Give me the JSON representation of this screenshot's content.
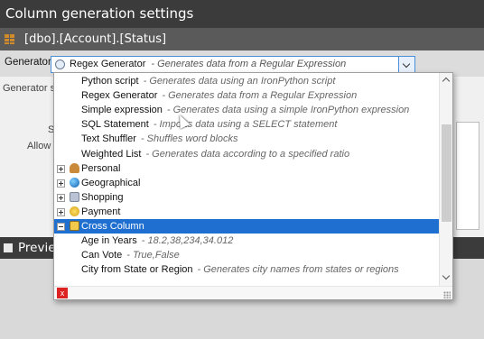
{
  "window": {
    "title": "Column generation settings",
    "object_path": "[dbo].[Account].[Status]"
  },
  "generator": {
    "label": "Generator:",
    "selected_name": "Regex Generator",
    "selected_desc": "- Generates data from a Regular Expression"
  },
  "background": {
    "generator_settings_partial": "Generator se",
    "s_partial": "S",
    "allow_partial": "Allow n"
  },
  "dropdown": {
    "rows": [
      {
        "kind": "child",
        "name": "Python script",
        "desc": "- Generates data using an IronPython script"
      },
      {
        "kind": "child",
        "name": "Regex Generator",
        "desc": "- Generates data from a Regular Expression"
      },
      {
        "kind": "child",
        "name": "Simple expression",
        "desc": "- Generates data using a simple IronPython expression"
      },
      {
        "kind": "child",
        "name": "SQL Statement",
        "desc": "- Imports data using a SELECT statement"
      },
      {
        "kind": "child",
        "name": "Text Shuffler",
        "desc": "- Shuffles word blocks"
      },
      {
        "kind": "child",
        "name": "Weighted List",
        "desc": "- Generates data according to a specified ratio"
      },
      {
        "kind": "category",
        "name": "Personal",
        "icon": "person-icon"
      },
      {
        "kind": "category",
        "name": "Geographical",
        "icon": "globe-icon"
      },
      {
        "kind": "category",
        "name": "Shopping",
        "icon": "shopping-icon"
      },
      {
        "kind": "category",
        "name": "Payment",
        "icon": "coins-icon"
      },
      {
        "kind": "category",
        "name": "Cross Column",
        "icon": "cross-column-icon",
        "selected": true,
        "expanded": true
      },
      {
        "kind": "child",
        "name": "Age in Years",
        "desc": "- 18.2,38,234,34.012"
      },
      {
        "kind": "child",
        "name": "Can Vote",
        "desc": "- True,False"
      },
      {
        "kind": "child",
        "name": "City from State or Region",
        "desc": "- Generates city names from states or regions"
      }
    ]
  },
  "preview": {
    "label": "Previe"
  },
  "colors": {
    "title_bar": "#3b3b3b",
    "selection": "#1e6fd0",
    "dropdown_border": "#4a90d9"
  }
}
